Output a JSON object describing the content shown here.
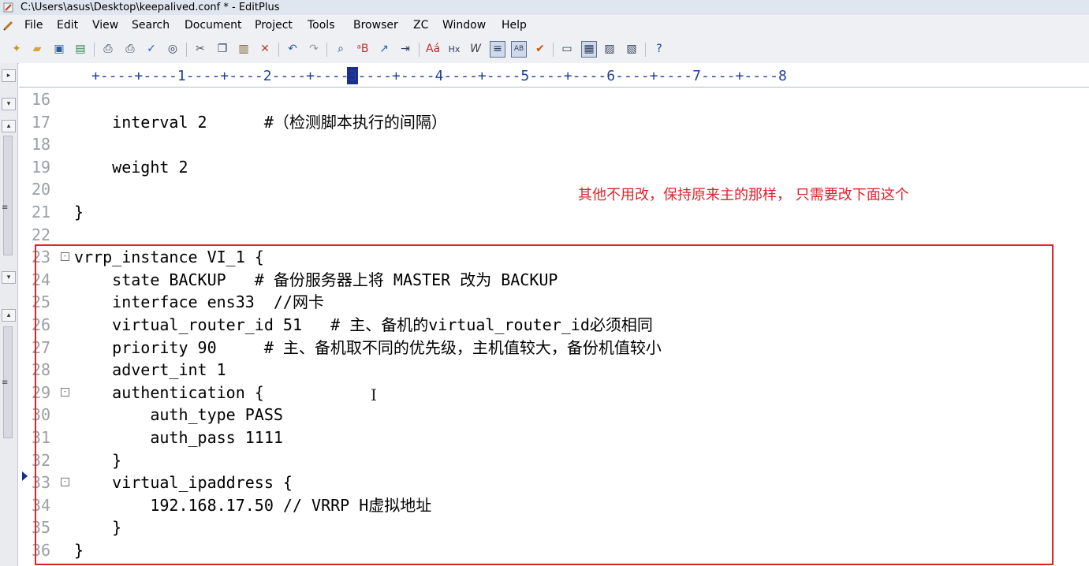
{
  "window": {
    "title": "C:\\Users\\asus\\Desktop\\keepalived.conf * - EditPlus"
  },
  "menu": [
    "File",
    "Edit",
    "View",
    "Search",
    "Document",
    "Project",
    "Tools",
    "Browser",
    "ZC",
    "Window",
    "Help"
  ],
  "toolbar_icons": [
    "new-file-icon",
    "open-folder-icon",
    "save-icon",
    "save-all-icon",
    "print-preview-icon",
    "print-icon",
    "spell-check-icon",
    "browser-icon",
    "cut-icon",
    "copy-icon",
    "paste-icon",
    "delete-icon",
    "undo-icon",
    "redo-icon",
    "find-icon",
    "replace-icon",
    "goto-icon",
    "indent-icon",
    "font-icon",
    "hex-icon",
    "word-wrap-icon",
    "line-numbers-icon",
    "column-select-icon",
    "check-icon",
    "window-1-icon",
    "window-2-icon",
    "window-3-icon",
    "window-4-icon",
    "help-icon"
  ],
  "ruler": "+----+----1----+----2----+----3----+----4----+----5----+----6----+----7----+----8",
  "editor": {
    "lines": [
      {
        "num": "16",
        "code": ""
      },
      {
        "num": "17",
        "code": "    interval 2      #（检测脚本执行的间隔）"
      },
      {
        "num": "18",
        "code": ""
      },
      {
        "num": "19",
        "code": "    weight 2"
      },
      {
        "num": "20",
        "code": ""
      },
      {
        "num": "21",
        "code": "}"
      },
      {
        "num": "22",
        "code": ""
      },
      {
        "num": "23",
        "code": "vrrp_instance VI_1 {"
      },
      {
        "num": "24",
        "code": "    state BACKUP   # 备份服务器上将 MASTER 改为 BACKUP"
      },
      {
        "num": "25",
        "code": "    interface ens33  //网卡"
      },
      {
        "num": "26",
        "code": "    virtual_router_id 51   # 主、备机的virtual_router_id必须相同"
      },
      {
        "num": "27",
        "code": "    priority 90     # 主、备机取不同的优先级，主机值较大，备份机值较小"
      },
      {
        "num": "28",
        "code": "    advert_int 1"
      },
      {
        "num": "29",
        "code": "    authentication {"
      },
      {
        "num": "30",
        "code": "        auth_type PASS"
      },
      {
        "num": "31",
        "code": "        auth_pass 1111"
      },
      {
        "num": "32",
        "code": "    }"
      },
      {
        "num": "33",
        "code": "    virtual_ipaddress {"
      },
      {
        "num": "34",
        "code": "        192.168.17.50 // VRRP H虚拟地址"
      },
      {
        "num": "35",
        "code": "    }"
      },
      {
        "num": "36",
        "code": "}"
      }
    ]
  },
  "annotation": "其他不用改，保持原来主的那样， 只需要改下面这个",
  "colors": {
    "annotation": "#e0222a",
    "ruler": "#1f3f9e",
    "line_number": "#9aa0a6"
  }
}
